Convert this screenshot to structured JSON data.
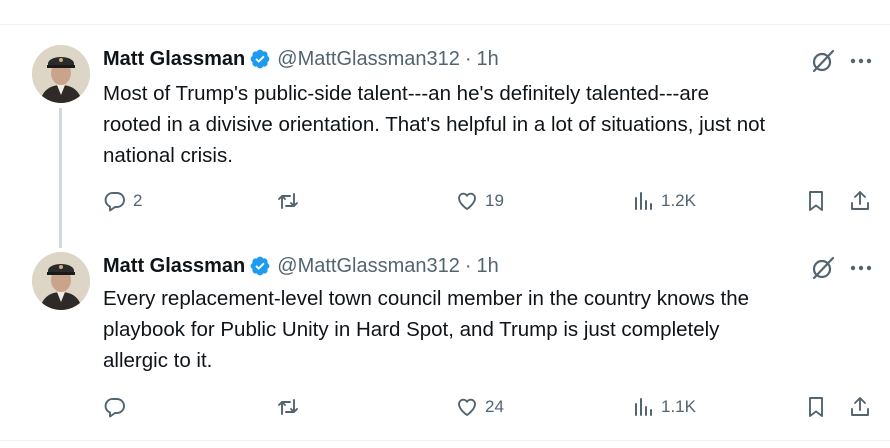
{
  "tweets": [
    {
      "author_name": "Matt Glassman",
      "handle": "@MattGlassman312",
      "separator": "·",
      "time": "1h",
      "text": "Most of Trump's public-side talent---an he's definitely talented---are\nrooted in a divisive orientation. That's helpful in a lot of situations, just not\nnational crisis.",
      "replies": "2",
      "retweets": "",
      "likes": "19",
      "views": "1.2K"
    },
    {
      "author_name": "Matt Glassman",
      "handle": "@MattGlassman312",
      "separator": "·",
      "time": "1h",
      "text": "Every replacement-level town council member in the country knows the\nplaybook for Public Unity in Hard Spot, and Trump is just completely\nallergic to it.",
      "replies": "",
      "retweets": "",
      "likes": "24",
      "views": "1.1K"
    }
  ],
  "icons": {
    "verified": "verified-badge-icon",
    "grok": "grok-icon",
    "more": "more-icon",
    "reply": "reply-icon",
    "retweet": "retweet-icon",
    "like": "heart-icon",
    "views": "views-icon",
    "bookmark": "bookmark-icon",
    "share": "share-icon"
  },
  "colors": {
    "verified_blue": "#1d9bf0",
    "text_primary": "#0f1419",
    "text_secondary": "#536471",
    "thread_line": "#cfd9de",
    "divider": "#eff3f4"
  }
}
